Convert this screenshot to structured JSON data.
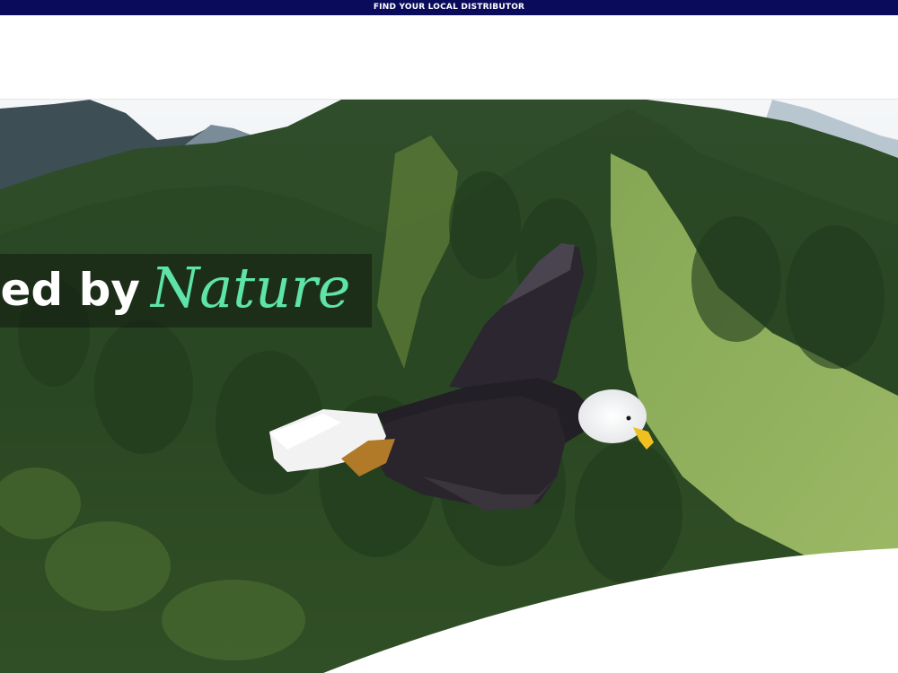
{
  "topbar": {
    "link_label": "FIND YOUR LOCAL DISTRIBUTOR",
    "background_color": "#0b0b5c"
  },
  "hero": {
    "tagline_plain": "ed by",
    "tagline_script": "Nature",
    "tagline_script_color": "#5ee3a8",
    "background_image": "bald-eagle-flying-over-forested-mountains"
  }
}
